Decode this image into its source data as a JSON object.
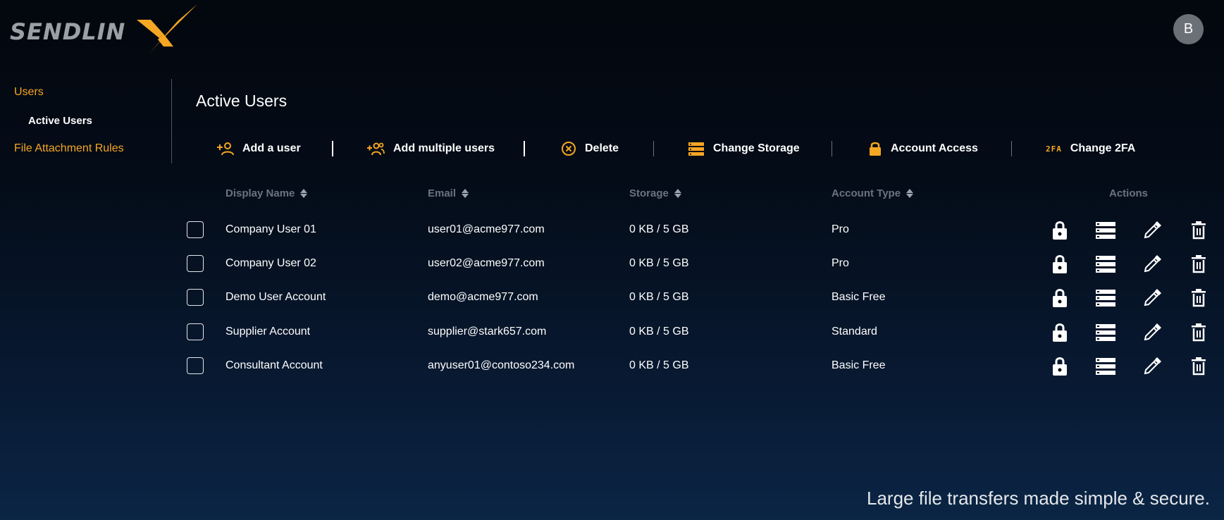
{
  "app": {
    "logo_text": "SENDLIN",
    "avatar_initial": "B"
  },
  "sidebar": {
    "users": "Users",
    "active_users": "Active Users",
    "file_attachment_rules": "File Attachment Rules"
  },
  "main": {
    "title": "Active Users",
    "toolbar": {
      "add_user": "Add a user",
      "add_multiple": "Add multiple users",
      "delete": "Delete",
      "change_storage": "Change Storage",
      "account_access": "Account Access",
      "change_2fa": "Change 2FA",
      "twofa_icon_text": "2FA"
    },
    "columns": {
      "display_name": "Display Name",
      "email": "Email",
      "storage": "Storage",
      "account_type": "Account Type",
      "actions": "Actions"
    },
    "rows": [
      {
        "name": "Company User 01",
        "email": "user01@acme977.com",
        "storage": "0 KB / 5 GB",
        "type": "Pro"
      },
      {
        "name": "Company User 02",
        "email": "user02@acme977.com",
        "storage": "0 KB / 5 GB",
        "type": "Pro"
      },
      {
        "name": "Demo User Account",
        "email": "demo@acme977.com",
        "storage": "0 KB / 5 GB",
        "type": "Basic Free"
      },
      {
        "name": "Supplier Account",
        "email": "supplier@stark657.com",
        "storage": "0 KB / 5 GB",
        "type": "Standard"
      },
      {
        "name": "Consultant Account",
        "email": "anyuser01@contoso234.com",
        "storage": "0 KB / 5 GB",
        "type": "Basic Free"
      }
    ]
  },
  "footer": {
    "tagline": "Large file transfers made simple & secure."
  },
  "colors": {
    "accent": "#f5a623",
    "background": "#03070e",
    "muted": "#6b7280"
  }
}
